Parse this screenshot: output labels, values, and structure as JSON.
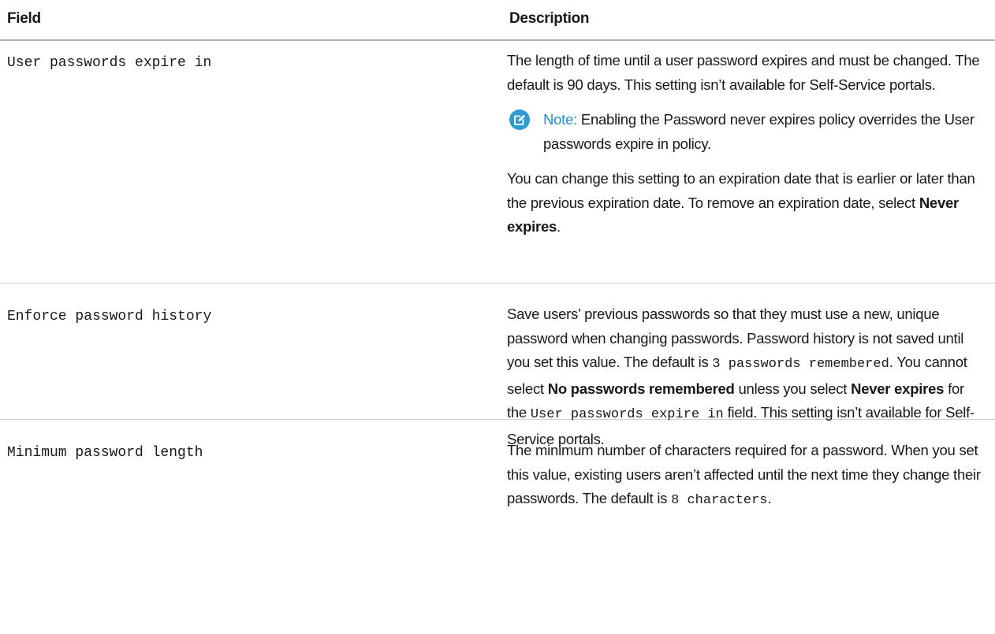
{
  "table": {
    "headers": {
      "field": "Field",
      "description": "Description"
    },
    "rows": [
      {
        "field": "User passwords expire in",
        "description": {
          "p1": "The length of time until a user password expires and must be changed. The default is 90 days. This setting isn’t available for Self-Service portals.",
          "note": {
            "icon": "edit-note-icon",
            "label": "Note:",
            "text": "Enabling the Password never expires policy overrides the User passwords expire in policy."
          },
          "p2_before": "You can change this setting to an expiration date that is earlier or later than the previous expiration date. To remove an expiration date, select ",
          "p2_bold": "Never expires",
          "p2_after": "."
        }
      },
      {
        "field": "Enforce password history",
        "description": {
          "t1": "Save users’ previous passwords so that they must use a new, unique password when changing passwords. Password history is not saved until you set this value. The default is ",
          "code1": "3 passwords remembered",
          "t2": ". You cannot select ",
          "bold1": "No passwords remembered",
          "t3": " unless you select ",
          "bold2": "Never expires",
          "t4": " for the ",
          "code2": "User passwords expire in",
          "t5": " field. This setting isn’t available for Self-Service portals."
        }
      },
      {
        "field": "Minimum password length",
        "description": {
          "t1": "The minimum number of characters required for a password. When you set this value, existing users aren’t affected until the next time they change their passwords. The default is ",
          "code1": "8 characters",
          "t2": "."
        }
      }
    ]
  },
  "colors": {
    "note_accent": "#1f8fd0",
    "note_icon_bg": "#2e9bd5",
    "rule": "#cfcfcf",
    "header_rule": "#b0b0b0"
  }
}
